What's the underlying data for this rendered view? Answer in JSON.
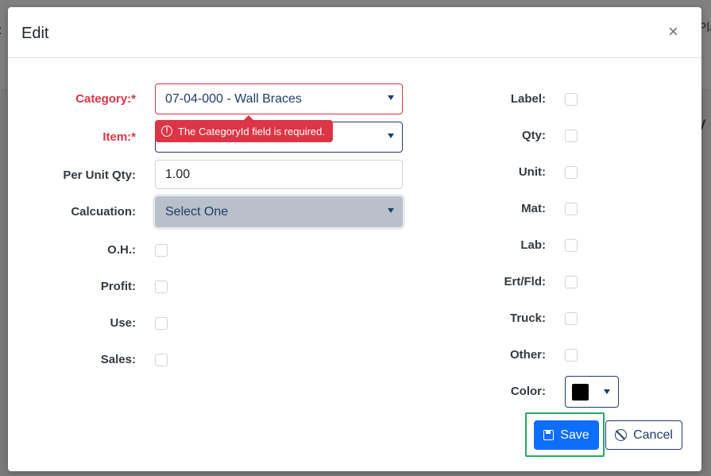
{
  "background": {
    "left_fragment": ":",
    "right_fragment": "Pla",
    "right_fragment2": "y",
    "right_fragment3": "."
  },
  "modal": {
    "title": "Edit",
    "close_glyph": "×"
  },
  "form_left": {
    "category": {
      "label": "Category:*",
      "value": "07-04-000 - Wall Braces"
    },
    "item": {
      "label": "Item:*",
      "value": ""
    },
    "validation_message": "The CategoryId field is required.",
    "per_unit_qty": {
      "label": "Per Unit Qty:",
      "value": "1.00"
    },
    "calculation": {
      "label": "Calcuation:",
      "value": "Select One"
    },
    "oh": {
      "label": "O.H.:",
      "checked": false
    },
    "profit": {
      "label": "Profit:",
      "checked": false
    },
    "use": {
      "label": "Use:",
      "checked": false
    },
    "sales": {
      "label": "Sales:",
      "checked": false
    }
  },
  "form_right": {
    "label": {
      "label": "Label:",
      "checked": false
    },
    "qty": {
      "label": "Qty:",
      "checked": false
    },
    "unit": {
      "label": "Unit:",
      "checked": false
    },
    "mat": {
      "label": "Mat:",
      "checked": false
    },
    "lab": {
      "label": "Lab:",
      "checked": false
    },
    "ert_fld": {
      "label": "Ert/Fld:",
      "checked": false
    },
    "truck": {
      "label": "Truck:",
      "checked": false
    },
    "other": {
      "label": "Other:",
      "checked": false
    },
    "color": {
      "label": "Color:",
      "value": "#000000"
    }
  },
  "buttons": {
    "save": "Save",
    "cancel": "Cancel"
  },
  "colors": {
    "required_label": "#dc3545",
    "primary": "#0d6efd",
    "highlight": "#2aa56b"
  }
}
